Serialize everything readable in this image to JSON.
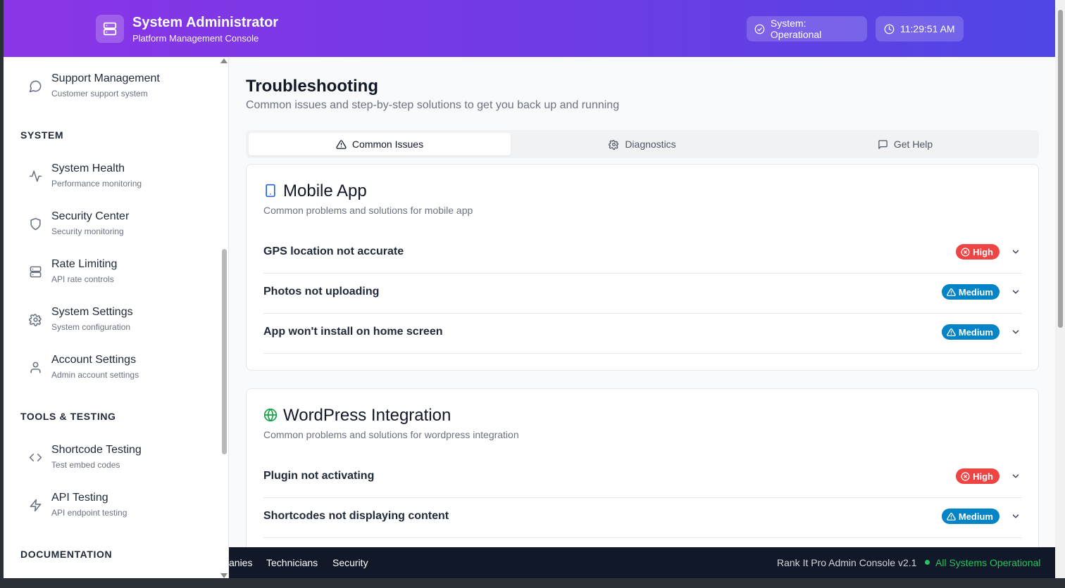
{
  "header": {
    "title": "System Administrator",
    "subtitle": "Platform Management Console",
    "status": "System: Operational",
    "time": "11:29:51 AM"
  },
  "sidebar": {
    "items_top": [
      {
        "label": "Support Management",
        "sub": "Customer support system",
        "icon": "chat-icon"
      }
    ],
    "section_system": "SYSTEM",
    "system_items": [
      {
        "label": "System Health",
        "sub": "Performance monitoring",
        "icon": "activity-icon"
      },
      {
        "label": "Security Center",
        "sub": "Security monitoring",
        "icon": "shield-icon"
      },
      {
        "label": "Rate Limiting",
        "sub": "API rate controls",
        "icon": "server-icon"
      },
      {
        "label": "System Settings",
        "sub": "System configuration",
        "icon": "gear-icon"
      },
      {
        "label": "Account Settings",
        "sub": "Admin account settings",
        "icon": "user-icon"
      }
    ],
    "section_tools": "TOOLS & TESTING",
    "tools_items": [
      {
        "label": "Shortcode Testing",
        "sub": "Test embed codes",
        "icon": "code-icon"
      },
      {
        "label": "API Testing",
        "sub": "API endpoint testing",
        "icon": "zap-icon"
      }
    ],
    "section_docs": "DOCUMENTATION"
  },
  "main": {
    "title": "Troubleshooting",
    "subtitle": "Common issues and step-by-step solutions to get you back up and running",
    "tabs": [
      {
        "label": "Common Issues",
        "icon": "warning-icon",
        "active": true
      },
      {
        "label": "Diagnostics",
        "icon": "gear-icon",
        "active": false
      },
      {
        "label": "Get Help",
        "icon": "chat-icon",
        "active": false
      }
    ],
    "cards": [
      {
        "title": "Mobile App",
        "icon": "phone-icon",
        "icon_color": "#2563eb",
        "subtitle": "Common problems and solutions for mobile app",
        "issues": [
          {
            "title": "GPS location not accurate",
            "severity": "High"
          },
          {
            "title": "Photos not uploading",
            "severity": "Medium"
          },
          {
            "title": "App won't install on home screen",
            "severity": "Medium"
          }
        ]
      },
      {
        "title": "WordPress Integration",
        "icon": "globe-icon",
        "icon_color": "#16a34a",
        "subtitle": "Common problems and solutions for wordpress integration",
        "issues": [
          {
            "title": "Plugin not activating",
            "severity": "High"
          },
          {
            "title": "Shortcodes not displaying content",
            "severity": "Medium"
          }
        ]
      }
    ]
  },
  "footer": {
    "links": [
      "anies",
      "Technicians",
      "Security"
    ],
    "version": "Rank It Pro Admin Console v2.1",
    "status": "All Systems Operational"
  },
  "colors": {
    "header_start": "#8b35e6",
    "header_end": "#4f46e5",
    "high": "#ef4444",
    "medium": "#0284c7",
    "ok": "#22c55e"
  }
}
